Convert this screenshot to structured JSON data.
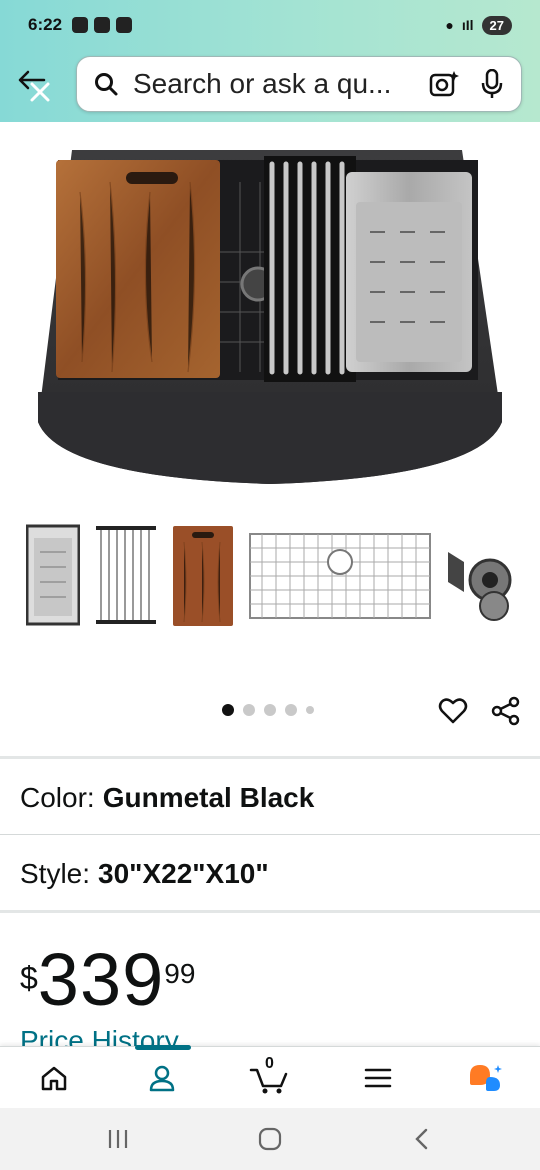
{
  "status_bar": {
    "time": "6:22",
    "battery": "27"
  },
  "search": {
    "placeholder": "Search or ask a qu..."
  },
  "pager": {
    "total": 5,
    "active_index": 0
  },
  "options": [
    {
      "label": "Color:",
      "value": "Gunmetal Black"
    },
    {
      "label": "Style:",
      "value": "30\"X22\"X10\""
    }
  ],
  "price": {
    "currency": "$",
    "whole": "339",
    "fraction": "99"
  },
  "links": {
    "price_history": "Price History"
  },
  "bottom_nav": {
    "items": [
      {
        "icon": "home-icon"
      },
      {
        "icon": "account-icon",
        "active": true
      },
      {
        "icon": "cart-icon",
        "badge": "0"
      },
      {
        "icon": "menu-icon"
      },
      {
        "icon": "rufus-assistant-icon"
      }
    ]
  },
  "colors": {
    "accent": "#007185",
    "header_from": "#86d9d6",
    "header_to": "#b6e8cf",
    "assistant_orange": "#ff7b24",
    "assistant_blue": "#1f8cff"
  }
}
